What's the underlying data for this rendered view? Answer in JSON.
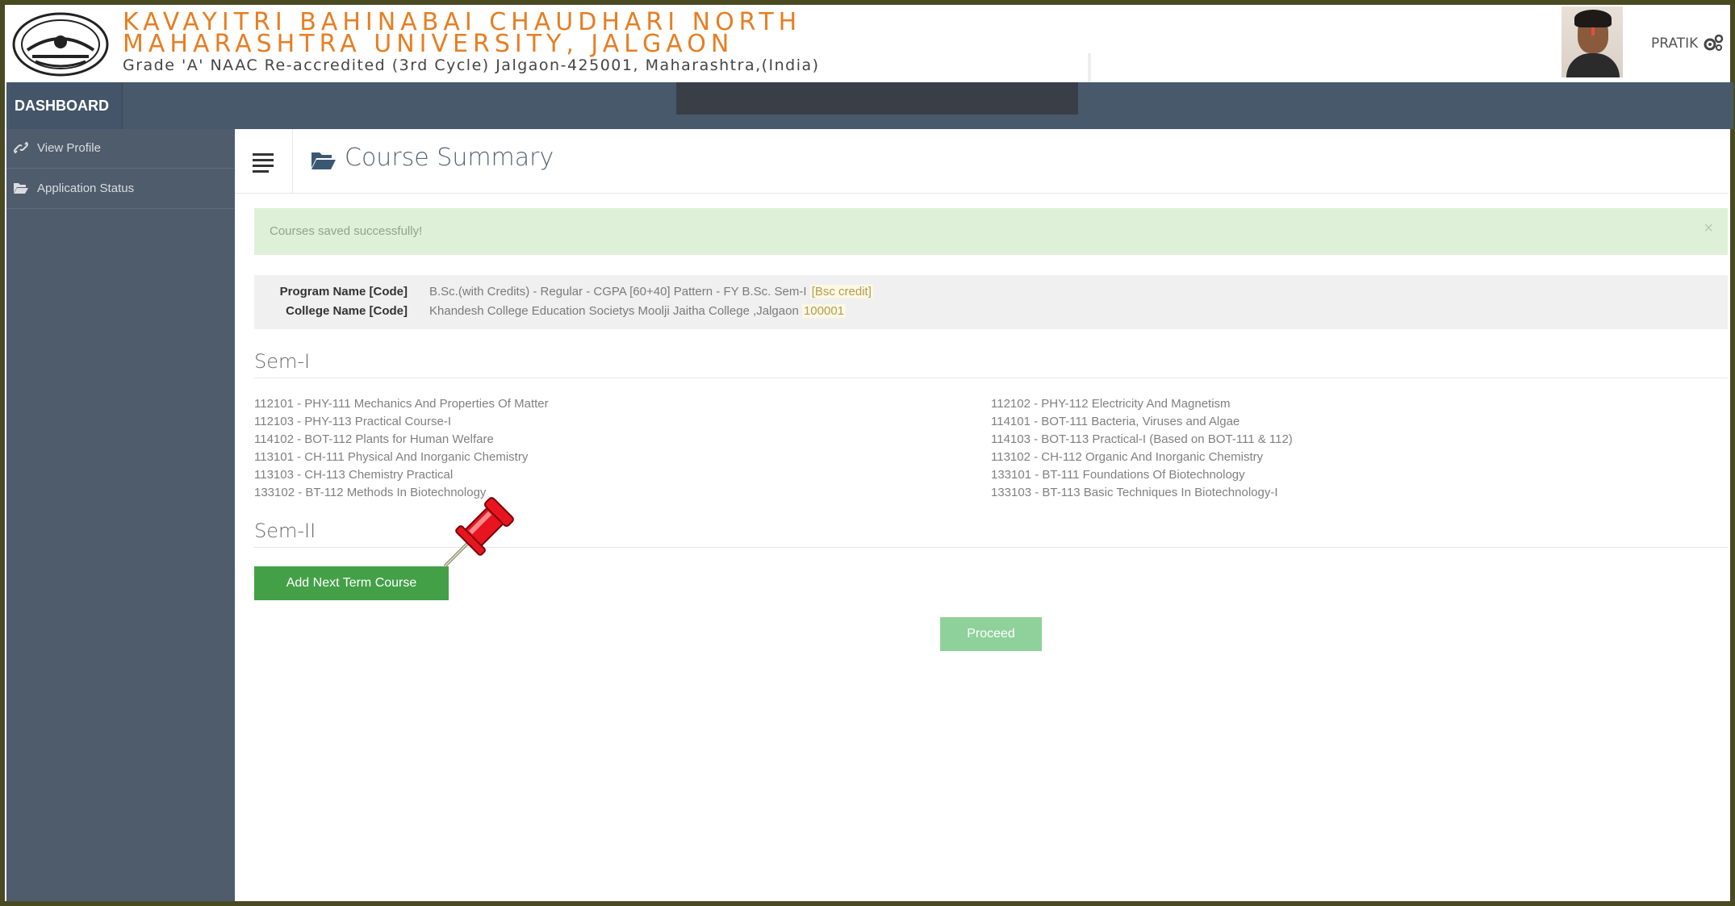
{
  "header": {
    "university_line1": "KAVAYITRI BAHINABAI CHAUDHARI NORTH",
    "university_line2": "MAHARASHTRA UNIVERSITY, JALGAON",
    "subtitle": "Grade 'A' NAAC Re-accredited (3rd Cycle) Jalgaon-425001, Maharashtra,(India)",
    "user_name": "PRATIK",
    "brand_color": "#e67e22"
  },
  "topbar": {
    "dashboard_label": "DASHBOARD"
  },
  "sidebar": {
    "items": [
      {
        "label": "View Profile",
        "icon": "link-icon"
      },
      {
        "label": "Application Status",
        "icon": "folder-open-icon"
      }
    ]
  },
  "main": {
    "title": "Course Summary",
    "alert": {
      "message": "Courses saved successfully!",
      "close": "×"
    },
    "program_label": "Program Name [Code]",
    "program_value": "B.Sc.(with Credits) - Regular - CGPA [60+40] Pattern - FY B.Sc. Sem-I",
    "program_code": "[Bsc credit]",
    "college_label": "College Name [Code]",
    "college_value": "Khandesh College Education Societys Moolji Jaitha College ,Jalgaon",
    "college_code": "100001",
    "sem1_heading": "Sem-I",
    "sem1_courses_left": [
      "112101 - PHY-111 Mechanics And Properties Of Matter",
      "112103 - PHY-113 Practical Course-I",
      "114102 - BOT-112 Plants for Human Welfare",
      "113101 - CH-111 Physical And Inorganic Chemistry",
      "113103 - CH-113 Chemistry Practical",
      "133102 - BT-112 Methods In Biotechnology"
    ],
    "sem1_courses_right": [
      "112102 - PHY-112 Electricity And Magnetism",
      "114101 - BOT-111 Bacteria, Viruses and Algae",
      "114103 - BOT-113 Practical-I (Based on BOT-111 & 112)",
      "113102 - CH-112 Organic And Inorganic Chemistry",
      "133101 - BT-111 Foundations Of Biotechnology",
      "133103 - BT-113 Basic Techniques In Biotechnology-I"
    ],
    "sem2_heading": "Sem-II",
    "add_button": "Add Next Term Course",
    "proceed_button": "Proceed"
  }
}
